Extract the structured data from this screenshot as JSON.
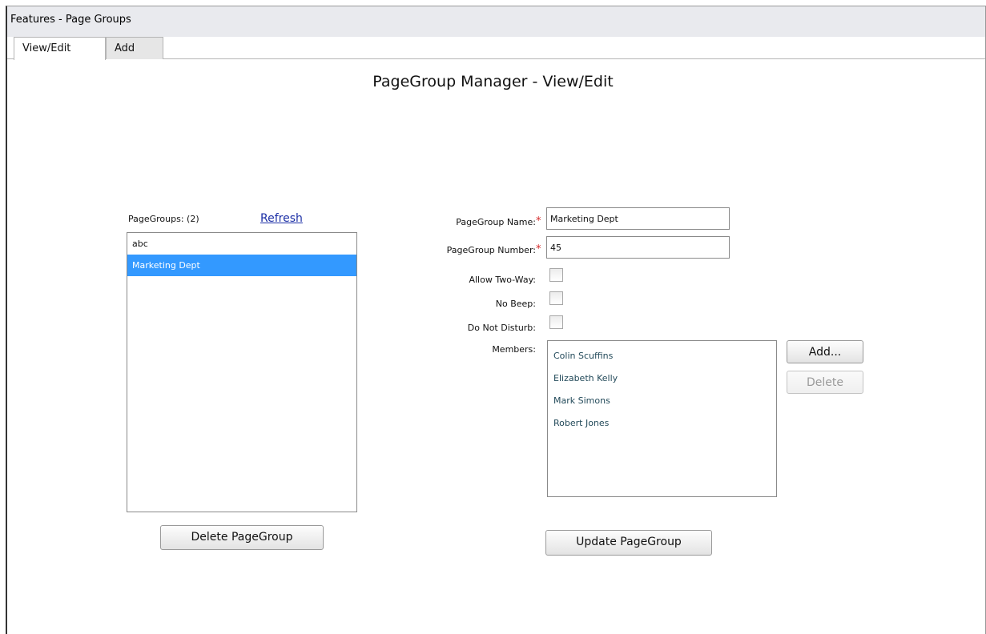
{
  "window": {
    "title": "Features - Page Groups"
  },
  "tabs": [
    {
      "label": "View/Edit",
      "active": true
    },
    {
      "label": "Add",
      "active": false
    }
  ],
  "page": {
    "title": "PageGroup Manager - View/Edit"
  },
  "group_list": {
    "count_label": "PageGroups: (2)",
    "refresh_label": "Refresh",
    "items": [
      {
        "label": "abc",
        "selected": false
      },
      {
        "label": "Marketing Dept",
        "selected": true
      }
    ],
    "delete_label": "Delete PageGroup"
  },
  "form": {
    "name_label": "PageGroup Name:",
    "name_value": "Marketing Dept",
    "number_label": "PageGroup Number:",
    "number_value": "45",
    "required_mark": "*",
    "allow_two_way_label": "Allow Two-Way:",
    "allow_two_way_checked": false,
    "no_beep_label": "No Beep:",
    "no_beep_checked": false,
    "do_not_disturb_label": "Do Not Disturb:",
    "do_not_disturb_checked": false,
    "members_label": "Members:",
    "members": [
      "Colin Scuffins",
      "Elizabeth Kelly",
      "Mark Simons",
      "Robert Jones"
    ],
    "add_member_label": "Add...",
    "delete_member_label": "Delete",
    "update_label": "Update PageGroup"
  },
  "colors": {
    "selection": "#3399ff",
    "link": "#1c2fa6",
    "required": "#d42b2b",
    "titlebar": "#e9eaee"
  }
}
